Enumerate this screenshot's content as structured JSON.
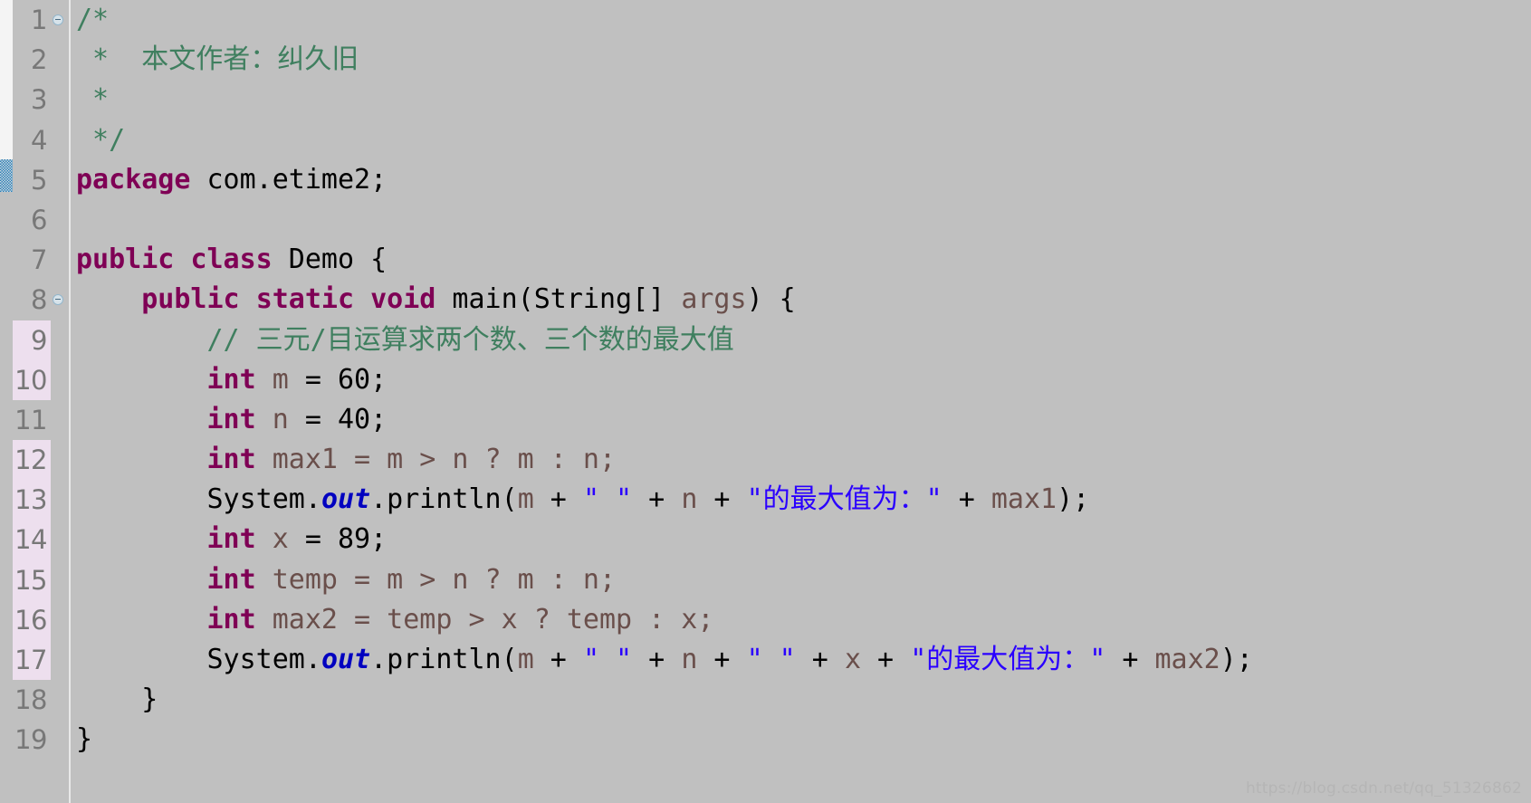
{
  "editor": {
    "language": "java",
    "background_color": "#c0c0c0",
    "changed_line_marker_color": "#eddfee",
    "watermark": "https://blog.csdn.net/qq_51326862",
    "colors": {
      "keyword": "#7f0055",
      "comment": "#3f7f5f",
      "string": "#2a00ff",
      "variable": "#6a4f4b",
      "static_field": "#0000c0",
      "plain": "#000000",
      "line_number": "#787878",
      "change_bar": "#2a7fb8"
    },
    "line_numbers": [
      "1",
      "2",
      "3",
      "4",
      "5",
      "6",
      "7",
      "8",
      "9",
      "10",
      "11",
      "12",
      "13",
      "14",
      "15",
      "16",
      "17",
      "18",
      "19"
    ],
    "changed_lines": [
      9,
      10,
      12,
      13,
      14,
      15,
      16,
      17
    ],
    "fold_marker_lines": [
      1,
      8
    ],
    "change_bar_lines": [
      5
    ],
    "lines": [
      {
        "num": "1",
        "text": "/*"
      },
      {
        "num": "2",
        "text": " *  本文作者：纠久旧"
      },
      {
        "num": "3",
        "text": " *"
      },
      {
        "num": "4",
        "text": " */"
      },
      {
        "num": "5",
        "text": "package com.etime2;"
      },
      {
        "num": "6",
        "text": ""
      },
      {
        "num": "7",
        "text": "public class Demo {"
      },
      {
        "num": "8",
        "text": "    public static void main(String[] args) {"
      },
      {
        "num": "9",
        "text": "        // 三元/目运算求两个数、三个数的最大值"
      },
      {
        "num": "10",
        "text": "        int m = 60;"
      },
      {
        "num": "11",
        "text": "        int n = 40;"
      },
      {
        "num": "12",
        "text": "        int max1 = m > n ? m : n;"
      },
      {
        "num": "13",
        "text": "        System.out.println(m + \" \" + n + \"的最大值为：\" + max1);"
      },
      {
        "num": "14",
        "text": "        int x = 89;"
      },
      {
        "num": "15",
        "text": "        int temp = m > n ? m : n;"
      },
      {
        "num": "16",
        "text": "        int max2 = temp > x ? temp : x;"
      },
      {
        "num": "17",
        "text": "        System.out.println(m + \" \" + n + \" \" + x + \"的最大值为：\" + max2);"
      },
      {
        "num": "18",
        "text": "    }"
      },
      {
        "num": "19",
        "text": "}"
      }
    ],
    "tokens": {
      "l1_comment": "/*",
      "l2_comment": " *  本文作者：纠久旧",
      "l3_comment": " *",
      "l4_comment": " */",
      "l5_kw": "package",
      "l5_rest": " com.etime2;",
      "l7_kw1": "public",
      "l7_sp1": " ",
      "l7_kw2": "class",
      "l7_rest": " Demo {",
      "l8_indent": "    ",
      "l8_kw1": "public",
      "l8_sp1": " ",
      "l8_kw2": "static",
      "l8_sp2": " ",
      "l8_kw3": "void",
      "l8_mid": " main(String[] ",
      "l8_arg": "args",
      "l8_end": ") {",
      "l9_indent": "        ",
      "l9_comment": "// 三元/目运算求两个数、三个数的最大值",
      "l10_indent": "        ",
      "l10_kw": "int",
      "l10_var": " m",
      "l10_rest": " = 60;",
      "l11_indent": "        ",
      "l11_kw": "int",
      "l11_var": " n",
      "l11_rest": " = 40;",
      "l12_indent": "        ",
      "l12_kw": "int",
      "l12_expr": " max1 = m > n ? m : n;",
      "l13_indent": "        ",
      "l13_a": "System.",
      "l13_out": "out",
      "l13_b": ".println(",
      "l13_m": "m",
      "l13_plus1": " + ",
      "l13_s1": "\" \"",
      "l13_plus2": " + ",
      "l13_n": "n",
      "l13_plus3": " + ",
      "l13_s2": "\"的最大值为：\"",
      "l13_plus4": " + ",
      "l13_max": "max1",
      "l13_end": ");",
      "l14_indent": "        ",
      "l14_kw": "int",
      "l14_var": " x",
      "l14_rest": " = 89;",
      "l15_indent": "        ",
      "l15_kw": "int",
      "l15_expr": " temp = m > n ? m : n;",
      "l16_indent": "        ",
      "l16_kw": "int",
      "l16_expr": " max2 = temp > x ? temp : x;",
      "l17_indent": "        ",
      "l17_a": "System.",
      "l17_out": "out",
      "l17_b": ".println(",
      "l17_m": "m",
      "l17_plus1": " + ",
      "l17_s1": "\" \"",
      "l17_plus2": " + ",
      "l17_n": "n",
      "l17_plus3": " + ",
      "l17_s2": "\" \"",
      "l17_plus4": " + ",
      "l17_x": "x",
      "l17_plus5": " + ",
      "l17_s3": "\"的最大值为：\"",
      "l17_plus6": " + ",
      "l17_max": "max2",
      "l17_end": ");",
      "l18": "    }",
      "l19": "}"
    }
  }
}
